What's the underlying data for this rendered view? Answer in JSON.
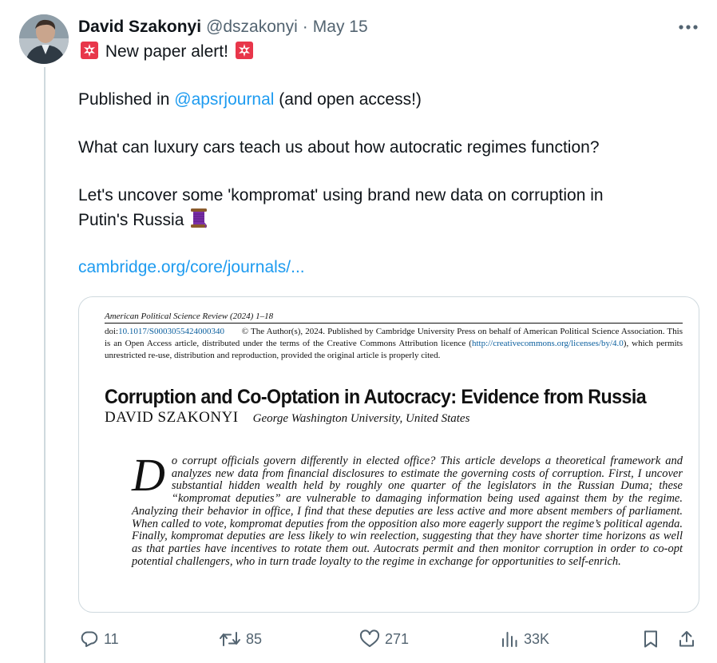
{
  "tweet": {
    "author_name": "David Szakonyi",
    "handle": "@dszakonyi",
    "separator": "·",
    "date": "May 15",
    "line1": " New paper alert! ",
    "published_prefix": "Published in ",
    "mention": "@apsrjournal",
    "published_suffix": " (and open access!)",
    "question": "What can luxury cars teach us about how autocratic regimes function?",
    "uncover_line1": "Let's uncover some 'kompromat' using brand new data on corruption in",
    "uncover_line2": "Putin's Russia ",
    "link": "cambridge.org/core/journals/..."
  },
  "paper": {
    "journal": "American Political Science Review (2024) 1–18",
    "doi_prefix": "doi:",
    "doi": "10.1017/S0003055424000340",
    "copyright_1": "© The Author(s), 2024. Published by Cambridge University Press on behalf of American Political Science Association. This is an Open Access article, distributed under the terms of the Creative Commons Attribution licence (",
    "license_url": "http://creativecommons.org/licenses/by/4.0",
    "copyright_2": "), which permits unrestricted re-use, distribution and reproduction, provided the original article is properly cited.",
    "title": "Corruption and Co-Optation in Autocracy: Evidence from Russia",
    "author": "DAVID SZAKONYI",
    "affiliation": "George Washington University, United States",
    "dropcap": "D",
    "abstract": "o corrupt officials govern differently in elected office? This article develops a theoretical framework and analyzes new data from financial disclosures to estimate the governing costs of corruption. First, I uncover substantial hidden wealth held by roughly one quarter of the legislators in the Russian Duma; these “kompromat deputies” are vulnerable to damaging information being used against them by the regime. Analyzing their behavior in office, I find that these deputies are less active and more absent members of parliament. When called to vote, kompromat deputies from the opposition also more eagerly support the regime’s political agenda. Finally, kompromat deputies are less likely to win reelection, suggesting that they have shorter time horizons as well as that parties have incentives to rotate them out. Autocrats permit and then monitor corruption in order to co-opt potential challengers, who in turn trade loyalty to the regime in exchange for opportunities to self-enrich."
  },
  "actions": {
    "replies": "11",
    "reposts": "85",
    "likes": "271",
    "views": "33K"
  },
  "icons": {
    "more": "more-icon",
    "reply": "reply-icon",
    "repost": "repost-icon",
    "like": "heart-icon",
    "views": "views-icon",
    "bookmark": "bookmark-icon",
    "share": "share-icon",
    "siren": "siren-emoji",
    "thread": "thread-emoji"
  },
  "colors": {
    "link": "#1d9bf0",
    "muted": "#536471",
    "text": "#0f1419"
  }
}
